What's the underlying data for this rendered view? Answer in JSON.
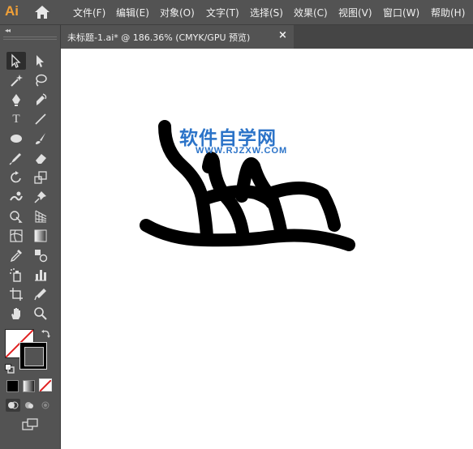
{
  "app": {
    "logo": "Ai",
    "accent": "#f1a037"
  },
  "menu": [
    {
      "label": "文件(F)"
    },
    {
      "label": "编辑(E)"
    },
    {
      "label": "对象(O)"
    },
    {
      "label": "文字(T)"
    },
    {
      "label": "选择(S)"
    },
    {
      "label": "效果(C)"
    },
    {
      "label": "视图(V)"
    },
    {
      "label": "窗口(W)"
    },
    {
      "label": "帮助(H)"
    }
  ],
  "panel": {
    "collapse_glyph": "◂◂"
  },
  "document_tab": {
    "title": "未标题-1.ai* @ 186.36% (CMYK/GPU 预览)",
    "close_glyph": "×"
  },
  "tools": [
    {
      "name": "selection-tool-icon"
    },
    {
      "name": "direct-selection-tool-icon"
    },
    {
      "name": "magic-wand-tool-icon"
    },
    {
      "name": "lasso-tool-icon"
    },
    {
      "name": "pen-tool-icon"
    },
    {
      "name": "curvature-tool-icon"
    },
    {
      "name": "type-tool-icon",
      "glyph": "T"
    },
    {
      "name": "line-segment-tool-icon"
    },
    {
      "name": "ellipse-tool-icon"
    },
    {
      "name": "paintbrush-tool-icon"
    },
    {
      "name": "pencil-tool-icon"
    },
    {
      "name": "eraser-tool-icon"
    },
    {
      "name": "rotate-tool-icon"
    },
    {
      "name": "scale-tool-icon"
    },
    {
      "name": "warp-tool-icon"
    },
    {
      "name": "puppet-warp-tool-icon"
    },
    {
      "name": "shape-builder-tool-icon"
    },
    {
      "name": "perspective-grid-tool-icon"
    },
    {
      "name": "mesh-tool-icon"
    },
    {
      "name": "gradient-tool-icon"
    },
    {
      "name": "eyedropper-tool-icon"
    },
    {
      "name": "blend-tool-icon"
    },
    {
      "name": "symbol-sprayer-tool-icon"
    },
    {
      "name": "column-graph-tool-icon"
    },
    {
      "name": "artboard-tool-icon"
    },
    {
      "name": "slice-tool-icon"
    },
    {
      "name": "hand-tool-icon"
    },
    {
      "name": "zoom-tool-icon"
    }
  ],
  "watermark": {
    "title": "软件自学网",
    "url": "WWW.RJZXW.COM",
    "color": "#2b73c8"
  },
  "artwork": {
    "stroke_color": "#000000"
  }
}
